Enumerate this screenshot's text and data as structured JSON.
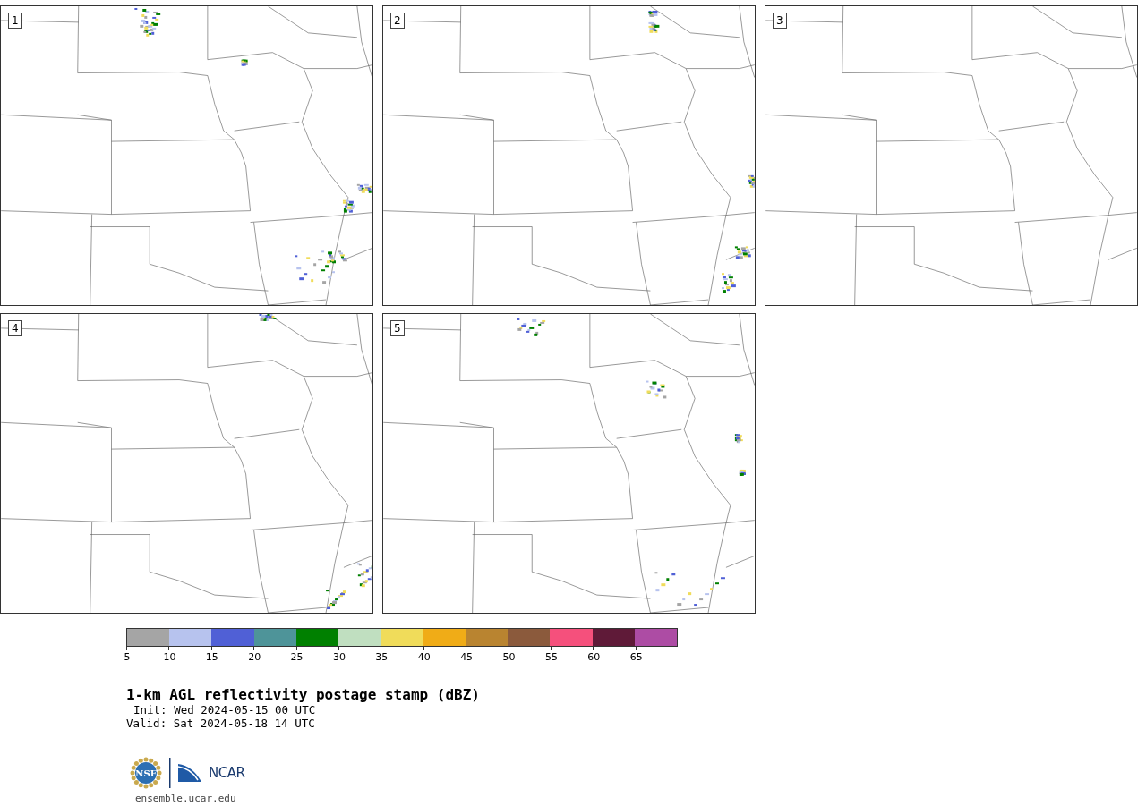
{
  "panels": [
    {
      "number": "1"
    },
    {
      "number": "2"
    },
    {
      "number": "3"
    },
    {
      "number": "4"
    },
    {
      "number": "5"
    }
  ],
  "colorbar": {
    "bins": [
      {
        "label": "5",
        "color": "#a5a5a5"
      },
      {
        "label": "10",
        "color": "#b7c3ee"
      },
      {
        "label": "15",
        "color": "#5060d6"
      },
      {
        "label": "20",
        "color": "#4e9499"
      },
      {
        "label": "25",
        "color": "#008000"
      },
      {
        "label": "30",
        "color": "#c0dfc0"
      },
      {
        "label": "35",
        "color": "#f0dc5a"
      },
      {
        "label": "40",
        "color": "#f0ac17"
      },
      {
        "label": "45",
        "color": "#b98430"
      },
      {
        "label": "50",
        "color": "#8b5a3c"
      },
      {
        "label": "55",
        "color": "#f5507c"
      },
      {
        "label": "60",
        "color": "#5f1a38"
      },
      {
        "label": "65",
        "color": "#ad4ca4"
      }
    ]
  },
  "title": "1-km AGL reflectivity postage stamp (dBZ)",
  "init": "Init: Wed 2024-05-15 00 UTC",
  "valid": "Valid: Sat 2024-05-18 14 UTC",
  "logos": {
    "nsf": "NSF",
    "ncar": "NCAR"
  },
  "url": "ensemble.ucar.edu"
}
